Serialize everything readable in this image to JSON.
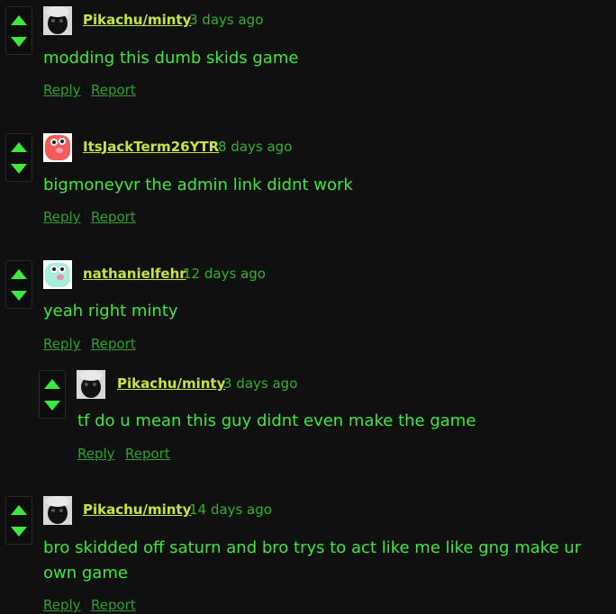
{
  "comments": [
    {
      "username": "Pikachu/minty",
      "time": "3 days ago",
      "text": "modding this dumb skids game",
      "reply": "Reply",
      "report": "Report",
      "avatar_icon": "animal-photo-avatar"
    },
    {
      "username": "ItsJackTerm26YTR",
      "time": "8 days ago",
      "text": "bigmoneyvr the admin link didnt work",
      "reply": "Reply",
      "report": "Report",
      "avatar_icon": "red-blob-avatar"
    },
    {
      "username": "nathanielfehr",
      "time": "12 days ago",
      "text": "yeah right minty",
      "reply": "Reply",
      "report": "Report",
      "avatar_icon": "mint-blob-avatar"
    },
    {
      "username": "Pikachu/minty",
      "time": "3 days ago",
      "text": "tf do u mean this guy didnt even make the game",
      "reply": "Reply",
      "report": "Report",
      "avatar_icon": "animal-photo-avatar"
    },
    {
      "username": "Pikachu/minty",
      "time": "14 days ago",
      "text": "bro skidded off saturn and bro trys to act like me like gng make ur own game",
      "reply": "Reply",
      "report": "Report",
      "avatar_icon": "animal-photo-avatar"
    }
  ],
  "colors": {
    "background": "#101010",
    "text": "#3ee83e",
    "username": "#c4e63e",
    "meta": "#2fb32f"
  }
}
